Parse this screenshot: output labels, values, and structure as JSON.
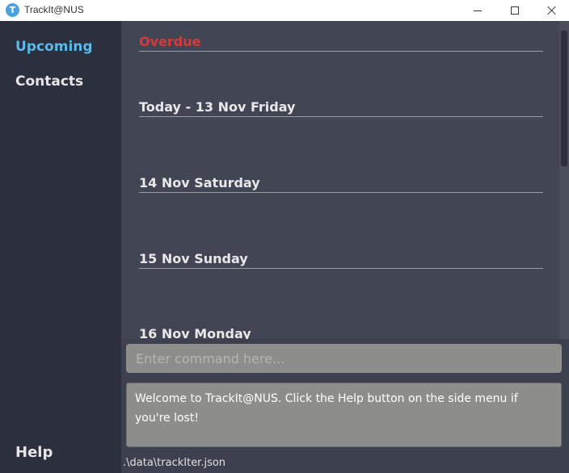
{
  "window": {
    "icon_letter": "T",
    "title": "TrackIt@NUS"
  },
  "sidebar": {
    "items": [
      {
        "label": "Upcoming"
      },
      {
        "label": "Contacts"
      }
    ],
    "help_label": "Help"
  },
  "upcoming": {
    "days": [
      {
        "label": "Overdue"
      },
      {
        "label": "Today - 13 Nov Friday"
      },
      {
        "label": "14 Nov Saturday"
      },
      {
        "label": "15 Nov Sunday"
      },
      {
        "label": "16 Nov Monday"
      }
    ]
  },
  "command": {
    "placeholder": "Enter command here...",
    "value": ""
  },
  "result": {
    "text": "Welcome to TrackIt@NUS. Click the Help button on the side menu if you're lost!"
  },
  "status": {
    "path": ".\\data\\trackIter.json"
  },
  "colors": {
    "accent": "#5cb8e8",
    "overdue": "#d63b3b",
    "sidebar_bg": "#2c2f3e",
    "list_bg": "#424553",
    "input_bg": "#8d8e8b"
  }
}
